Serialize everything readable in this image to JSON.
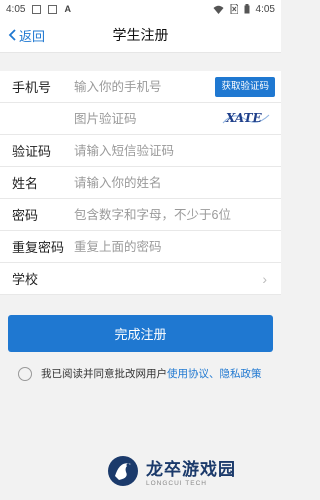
{
  "status_bar": {
    "time": "4:05"
  },
  "nav": {
    "back_label": "返回",
    "title": "学生注册"
  },
  "form": {
    "phone": {
      "label": "手机号",
      "placeholder": "输入你的手机号",
      "button": "获取验证码"
    },
    "image_code": {
      "placeholder": "图片验证码",
      "captcha_text": "XATE"
    },
    "sms_code": {
      "label": "验证码",
      "placeholder": "请输入短信验证码"
    },
    "name": {
      "label": "姓名",
      "placeholder": "请输入你的姓名"
    },
    "password": {
      "label": "密码",
      "placeholder": "包含数字和字母，不少于6位"
    },
    "confirm_password": {
      "label": "重复密码",
      "placeholder": "重复上面的密码"
    },
    "school": {
      "label": "学校",
      "value": "",
      "chevron": "›"
    }
  },
  "submit_label": "完成注册",
  "agreement": {
    "text": "我已阅读并同意批改网用户",
    "link1": "使用协议",
    "separator": "、",
    "link2": "隐私政策"
  },
  "watermark": {
    "cn": "龙卒游戏园",
    "en": "LONGCUI TECH"
  },
  "colors": {
    "accent": "#1f78d1",
    "background": "#f2f2f2"
  }
}
